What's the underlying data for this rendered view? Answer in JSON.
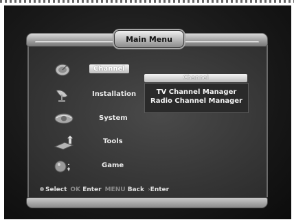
{
  "title": "Main Menu",
  "menu": {
    "items": [
      {
        "label": "Channel",
        "icon": "satellite-dish-icon",
        "selected": true
      },
      {
        "label": "Installation",
        "icon": "antenna-icon",
        "selected": false
      },
      {
        "label": "System",
        "icon": "globe-icon",
        "selected": false
      },
      {
        "label": "Tools",
        "icon": "tools-icon",
        "selected": false
      },
      {
        "label": "Game",
        "icon": "game-icon",
        "selected": false
      }
    ]
  },
  "submenu": {
    "header": "Channel",
    "entries": [
      "TV Channel Manager",
      "Radio Channel Manager"
    ]
  },
  "help": {
    "select_key": "",
    "select_label": "Select",
    "ok_key": "OK",
    "ok_label": "Enter",
    "menu_key": "MENU",
    "menu_label": "Back",
    "arrow_key": "",
    "arrow_label": "Enter"
  }
}
